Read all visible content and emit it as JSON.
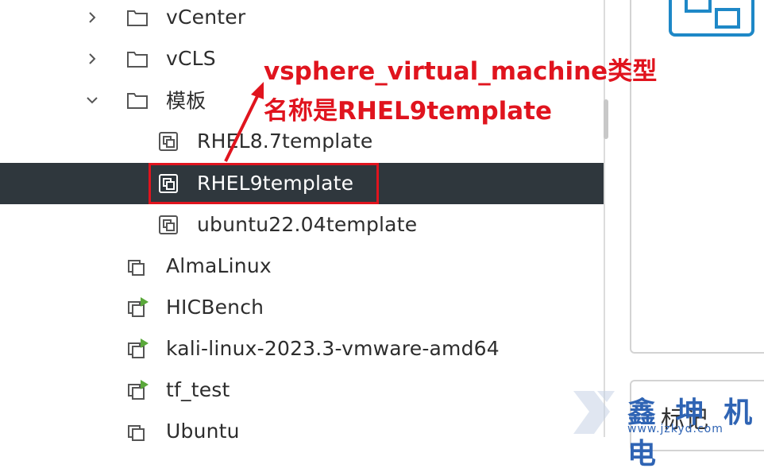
{
  "tree": {
    "folders": [
      {
        "label": "vCenter",
        "expanded": false
      },
      {
        "label": "vCLS",
        "expanded": false
      },
      {
        "label": "模板",
        "expanded": true
      }
    ],
    "templates": [
      {
        "label": "RHEL8.7template",
        "selected": false
      },
      {
        "label": "RHEL9template",
        "selected": true
      },
      {
        "label": "ubuntu22.04template",
        "selected": false
      }
    ],
    "vms": [
      {
        "label": "AlmaLinux",
        "powered_on": false
      },
      {
        "label": "HICBench",
        "powered_on": true
      },
      {
        "label": "kali-linux-2023.3-vmware-amd64",
        "powered_on": true
      },
      {
        "label": "tf_test",
        "powered_on": true
      },
      {
        "label": "Ubuntu",
        "powered_on": false
      }
    ]
  },
  "annotation": {
    "line1": "vsphere_virtual_machine类型",
    "line2": "名称是RHEL9template",
    "color": "#e0141e"
  },
  "right_panel": {
    "section_label": "标记"
  },
  "watermark": {
    "text": "鑫 坤 机 电",
    "url": "www.jzkyd.com"
  },
  "colors": {
    "selected_row": "#2f373d",
    "vm_power_on": "#5aa83a",
    "accent_icon": "#1e88c7"
  }
}
